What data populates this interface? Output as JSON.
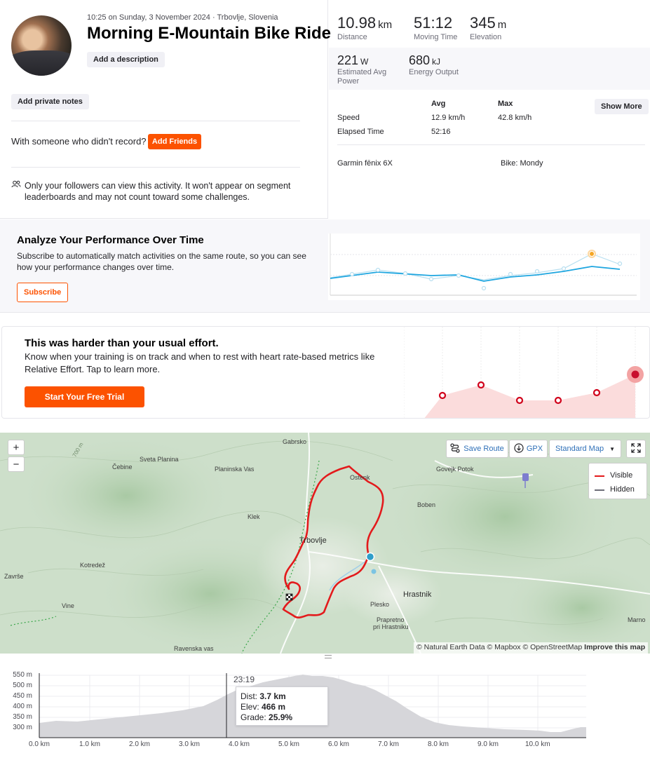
{
  "activity": {
    "meta": "10:25 on Sunday, 3 November 2024 · Trbovlje, Slovenia",
    "title": "Morning E-Mountain Bike Ride",
    "add_description": "Add a description",
    "add_private_notes": "Add private notes",
    "with_someone": "With someone who didn't record?",
    "add_friends": "Add Friends",
    "privacy_text": "Only your followers can view this activity. It won't appear on segment leaderboards and may not count toward some challenges."
  },
  "stats": {
    "distance": {
      "value": "10.98",
      "unit": "km",
      "label": "Distance"
    },
    "moving_time": {
      "value": "51:12",
      "label": "Moving Time"
    },
    "elevation": {
      "value": "345",
      "unit": "m",
      "label": "Elevation"
    },
    "power": {
      "value": "221",
      "unit": "W",
      "label": "Estimated Avg Power"
    },
    "energy": {
      "value": "680",
      "unit": "kJ",
      "label": "Energy Output"
    },
    "table": {
      "col_avg": "Avg",
      "col_max": "Max",
      "rows": [
        {
          "label": "Speed",
          "avg": "12.9 km/h",
          "max": "42.8 km/h"
        },
        {
          "label": "Elapsed Time",
          "avg": "52:16",
          "max": ""
        }
      ]
    },
    "show_more": "Show More",
    "device": "Garmin fēnix 6X",
    "bike": "Bike: Mondy"
  },
  "analyze": {
    "title": "Analyze Your Performance Over Time",
    "body": "Subscribe to automatically match activities on the same route, so you can see how your performance changes over time.",
    "button": "Subscribe"
  },
  "harder": {
    "title": "This was harder than your usual effort.",
    "body": "Know when your training is on track and when to rest with heart rate-based metrics like Relative Effort. Tap to learn more.",
    "button": "Start Your Free Trial"
  },
  "map": {
    "zoom_in": "+",
    "zoom_out": "−",
    "save_route": "Save Route",
    "gpx": "GPX",
    "map_style": "Standard Map",
    "legend_visible": "Visible",
    "legend_hidden": "Hidden",
    "attribution": "© Natural Earth Data © Mapbox © OpenStreetMap",
    "improve": "Improve this map",
    "places": {
      "gabrsko": "Gabrsko",
      "sveta_planina": "Sveta Planina",
      "cebine": "Čebine",
      "planinska_vas": "Planinska Vas",
      "ostenk": "Ostenk",
      "govejk_potok": "Govejk Potok",
      "boben": "Boben",
      "klek": "Klek",
      "trbovlje": "Trbovlje",
      "kotredez": "Kotredež",
      "zavine": "Završe",
      "vine": "Vine",
      "plesko": "Plesko",
      "hrastnik": "Hrastnik",
      "prapretno": "Prapretno",
      "pri_hrastniku": "pri Hrastniku",
      "marno": "Marno",
      "ravenska_vas": "Ravenska vas",
      "contour_700": "700 m"
    },
    "colors": {
      "route": "#e31a1c",
      "hidden": "#6d6d78",
      "start": "#2f9ec9"
    }
  },
  "elevation": {
    "y_ticks": [
      "550 m",
      "500 m",
      "450 m",
      "400 m",
      "350 m",
      "300 m"
    ],
    "x_ticks": [
      "0.0 km",
      "1.0 km",
      "2.0 km",
      "3.0 km",
      "4.0 km",
      "5.0 km",
      "6.0 km",
      "7.0 km",
      "8.0 km",
      "9.0 km",
      "10.0 km"
    ],
    "cursor_time": "23:19",
    "tooltip": {
      "dist_label": "Dist:",
      "dist_value": "3.7 km",
      "elev_label": "Elev:",
      "elev_value": "466 m",
      "grade_label": "Grade:",
      "grade_value": "25.9%"
    }
  }
}
